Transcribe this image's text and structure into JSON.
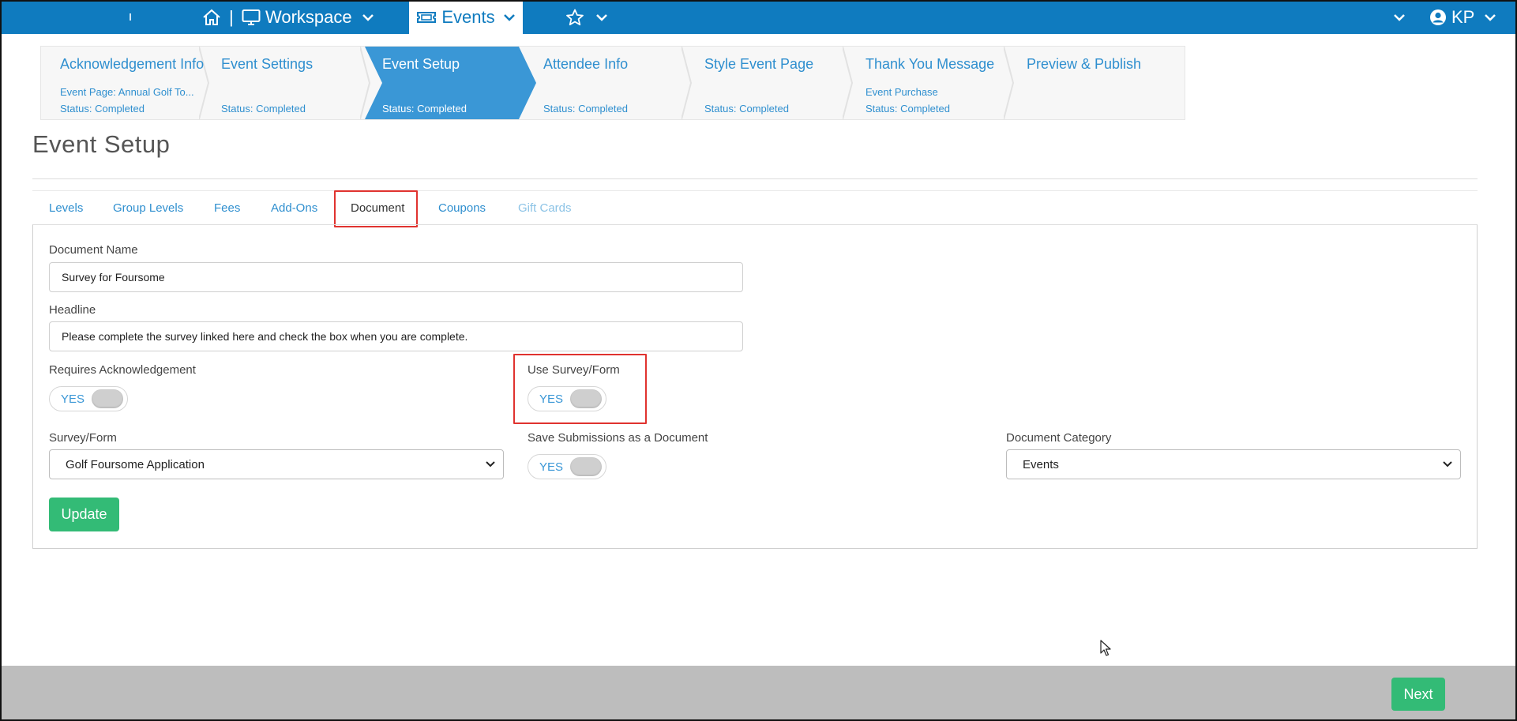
{
  "topbar": {
    "separator": "|",
    "workspace_label": "Workspace",
    "events_label": "Events",
    "user_initials": "KP",
    "bg_color": "#0f7bbf",
    "icons": [
      "home-icon",
      "monitor-icon",
      "chevron-down-icon",
      "ticket-icon",
      "star-icon",
      "user-circle-icon"
    ]
  },
  "wizard": {
    "steps": [
      {
        "title": "Acknowledgement Info",
        "sub1": "Event Page: Annual Golf To...",
        "sub2": "Status: Completed"
      },
      {
        "title": "Event Settings",
        "sub1": "",
        "sub2": "Status: Completed"
      },
      {
        "title": "Event Setup",
        "sub1": "",
        "sub2": "Status: Completed",
        "active": true
      },
      {
        "title": "Attendee Info",
        "sub1": "",
        "sub2": "Status: Completed"
      },
      {
        "title": "Style Event Page",
        "sub1": "",
        "sub2": "Status: Completed"
      },
      {
        "title": "Thank You Message",
        "sub1": "Event Purchase",
        "sub2": "Status: Completed"
      },
      {
        "title": "Preview & Publish",
        "sub1": "",
        "sub2": ""
      }
    ],
    "active_color": "#3a97d6"
  },
  "page": {
    "title": "Event Setup"
  },
  "tabs": [
    {
      "label": "Levels"
    },
    {
      "label": "Group Levels"
    },
    {
      "label": "Fees"
    },
    {
      "label": "Add-Ons"
    },
    {
      "label": "Document",
      "active": true
    },
    {
      "label": "Coupons"
    },
    {
      "label": "Gift Cards",
      "disabled": true
    }
  ],
  "form": {
    "document_name": {
      "label": "Document Name",
      "value": "Survey for Foursome"
    },
    "headline": {
      "label": "Headline",
      "value": "Please complete the survey linked here and check the box when you are complete."
    },
    "requires_ack": {
      "label": "Requires Acknowledgement",
      "toggle_text": "YES"
    },
    "use_survey": {
      "label": "Use Survey/Form",
      "toggle_text": "YES"
    },
    "survey_form": {
      "label": "Survey/Form",
      "value": "Golf Foursome Application"
    },
    "save_submissions": {
      "label": "Save Submissions as a Document",
      "toggle_text": "YES"
    },
    "doc_category": {
      "label": "Document Category",
      "value": "Events"
    },
    "update_label": "Update"
  },
  "footer": {
    "next_label": "Next"
  },
  "colors": {
    "link": "#2f8fcf",
    "success": "#33bb76",
    "highlight": "#e0332f"
  }
}
